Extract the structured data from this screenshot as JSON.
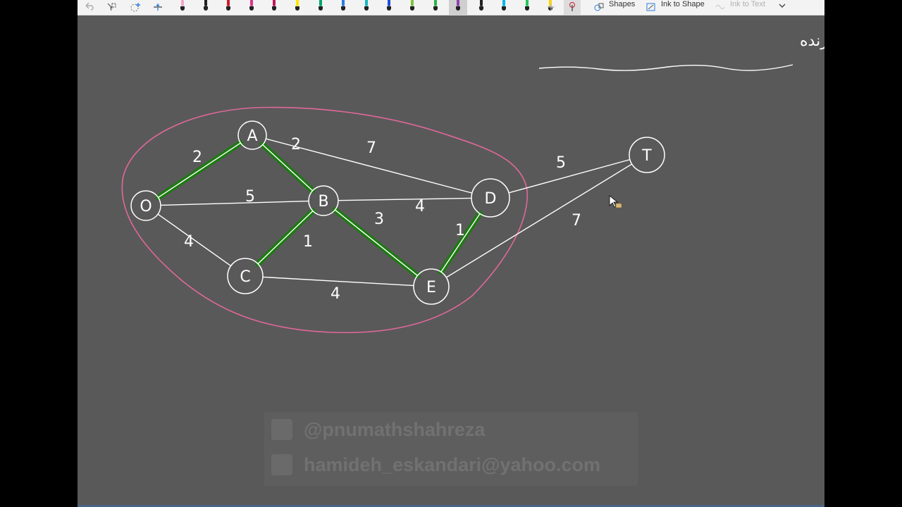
{
  "toolbar": {
    "shapes_label": "Shapes",
    "ink_to_shape_label": "Ink to Shape",
    "ink_to_text_label": "Ink to Text",
    "icons": [
      "undo-icon",
      "lasso-icon",
      "add-space-icon",
      "eraser-icon",
      "pen-icon",
      "highlighter-icon",
      "expand-icon"
    ],
    "pen_colors": [
      "#f2a7c9",
      "#222222",
      "#d11a2a",
      "#e0338a",
      "#c2185b",
      "#ffe600",
      "#00a86b",
      "#2a7de1",
      "#17b8c4",
      "#1e4fd6",
      "#7cc242",
      "#2bb24c",
      "#8e44ad",
      "#222222",
      "#00b7eb",
      "#26c65b",
      "#ffd400",
      "#222222"
    ]
  },
  "page": {
    "title_persian": "مسئله کوتاهترین درخت در برگیرنده"
  },
  "graph": {
    "nodes": [
      {
        "id": "A",
        "label": "A"
      },
      {
        "id": "O",
        "label": "O"
      },
      {
        "id": "B",
        "label": "B"
      },
      {
        "id": "C",
        "label": "C"
      },
      {
        "id": "D",
        "label": "D"
      },
      {
        "id": "E",
        "label": "E"
      },
      {
        "id": "T",
        "label": "T"
      }
    ],
    "edges": [
      {
        "from": "O",
        "to": "A",
        "weight": "2",
        "in_tree": true
      },
      {
        "from": "A",
        "to": "B",
        "weight": "2",
        "in_tree": true
      },
      {
        "from": "A",
        "to": "D",
        "weight": "7",
        "in_tree": false
      },
      {
        "from": "O",
        "to": "B",
        "weight": "5",
        "in_tree": false
      },
      {
        "from": "O",
        "to": "C",
        "weight": "4",
        "in_tree": false
      },
      {
        "from": "B",
        "to": "C",
        "weight": "1",
        "in_tree": true
      },
      {
        "from": "B",
        "to": "D",
        "weight": "4",
        "in_tree": false
      },
      {
        "from": "B",
        "to": "E",
        "weight": "3",
        "in_tree": true
      },
      {
        "from": "C",
        "to": "E",
        "weight": "4",
        "in_tree": false
      },
      {
        "from": "D",
        "to": "E",
        "weight": "1",
        "in_tree": true
      },
      {
        "from": "D",
        "to": "T",
        "weight": "5",
        "in_tree": false
      },
      {
        "from": "E",
        "to": "T",
        "weight": "7",
        "in_tree": false
      }
    ],
    "tree_color": "#1d7a12",
    "boundary_color": "#e0689a",
    "ink_color": "#ffffff"
  },
  "watermark": {
    "telegram": "@pnumathshahreza",
    "email": "hamideh_eskandari@yahoo.com"
  }
}
